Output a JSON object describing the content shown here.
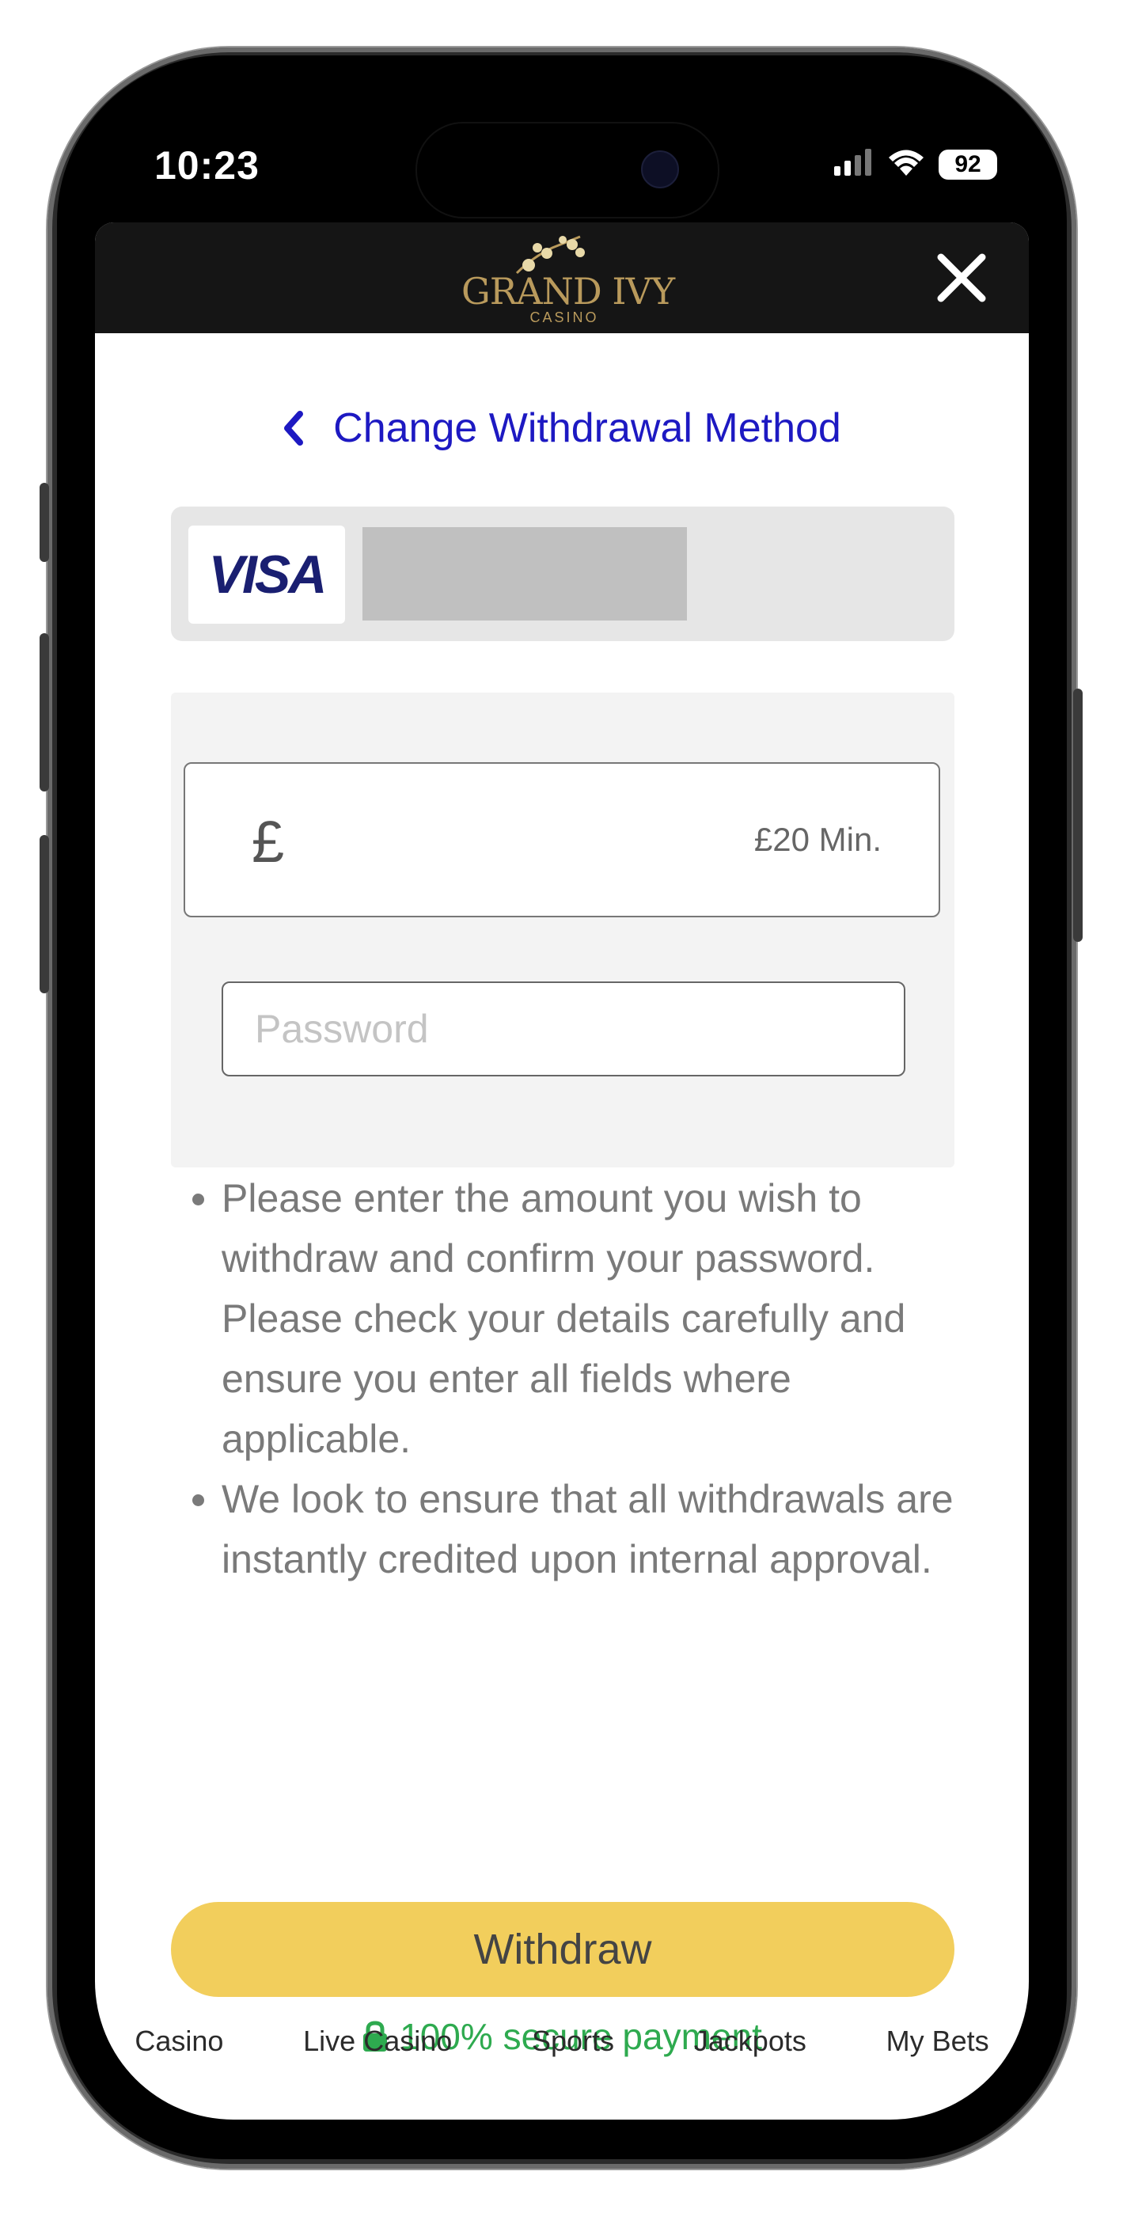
{
  "status_bar": {
    "time": "10:23",
    "battery": "92"
  },
  "header": {
    "logo_text": "GRAND IVY",
    "logo_subtext": "CASINO"
  },
  "back_link": {
    "label": "Change Withdrawal Method"
  },
  "payment_method": {
    "brand": "VISA"
  },
  "form": {
    "currency_symbol": "£",
    "amount_min_label": "£20 Min.",
    "password_placeholder": "Password"
  },
  "info": [
    "Please enter the amount you wish to withdraw and confirm your password. Please check your details carefully and ensure you enter all fields where applicable.",
    "We look to ensure that all withdrawals are instantly credited upon internal approval."
  ],
  "withdraw_button": {
    "label": "Withdraw"
  },
  "secure_note": {
    "label": "100% secure payment"
  },
  "bottom_nav": {
    "items": [
      "Casino",
      "Live Casino",
      "Sports",
      "Jackpots",
      "My Bets"
    ]
  },
  "colors": {
    "link": "#1d19c2",
    "button": "#f2ce5c",
    "secure": "#2eaa4f",
    "header_bg": "#151515",
    "logo_gold": "#b99a5c"
  }
}
